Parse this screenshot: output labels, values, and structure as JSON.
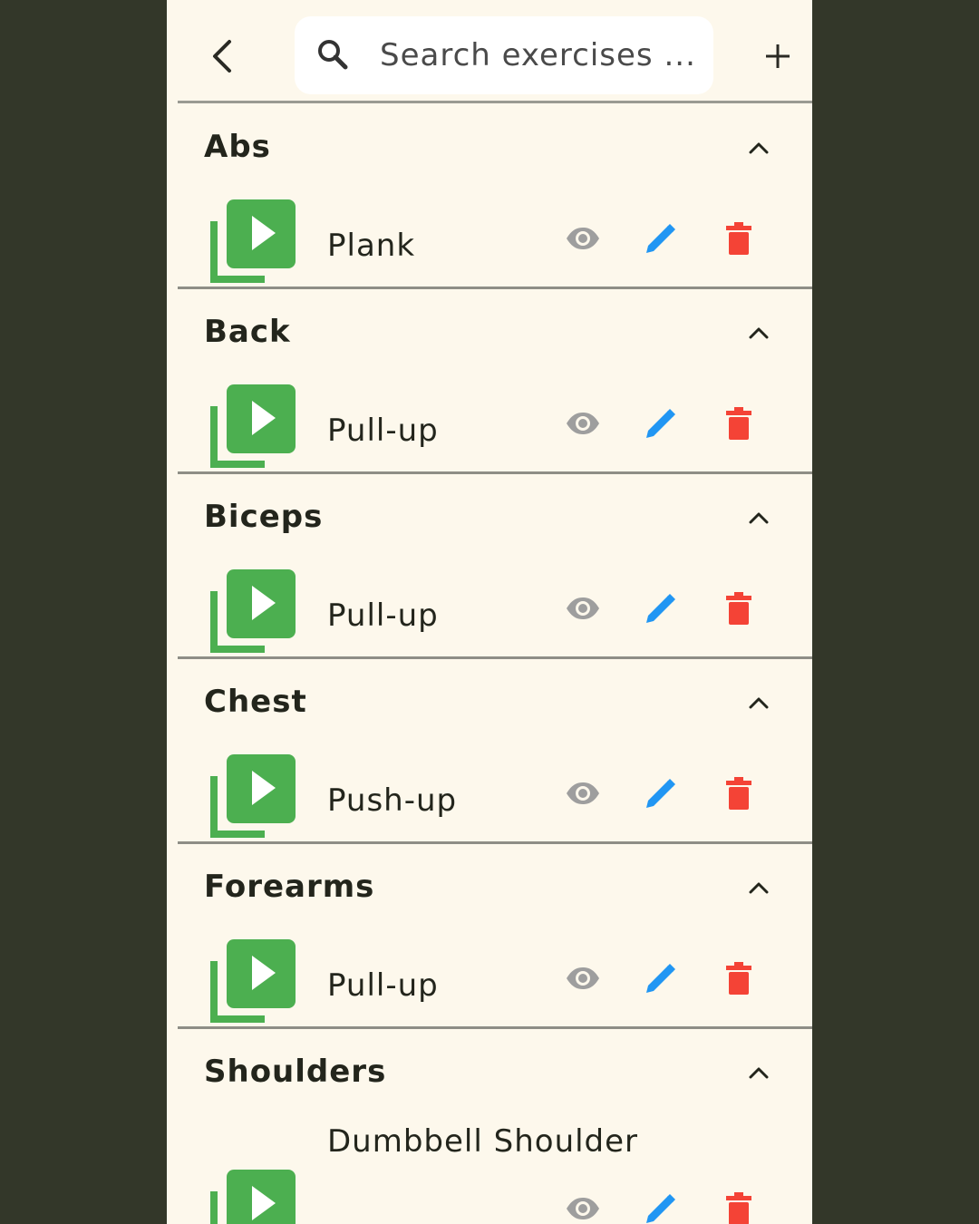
{
  "header": {
    "search_placeholder": "Search exercises ...",
    "back_icon": "chevron-left-icon",
    "add_icon": "plus-icon"
  },
  "colors": {
    "background": "#fdf8ec",
    "frame": "#333729",
    "video_icon": "#4caf50",
    "view_icon": "#9e9e9e",
    "edit_icon": "#2196f3",
    "delete_icon": "#f44336"
  },
  "groups": [
    {
      "title": "Abs",
      "exercises": [
        {
          "name": "Plank"
        }
      ]
    },
    {
      "title": "Back",
      "exercises": [
        {
          "name": "Pull-up"
        }
      ]
    },
    {
      "title": "Biceps",
      "exercises": [
        {
          "name": "Pull-up"
        }
      ]
    },
    {
      "title": "Chest",
      "exercises": [
        {
          "name": "Push-up"
        }
      ]
    },
    {
      "title": "Forearms",
      "exercises": [
        {
          "name": "Pull-up"
        }
      ]
    },
    {
      "title": "Shoulders",
      "exercises": [
        {
          "name": "Dumbbell Shoulder"
        }
      ]
    }
  ]
}
